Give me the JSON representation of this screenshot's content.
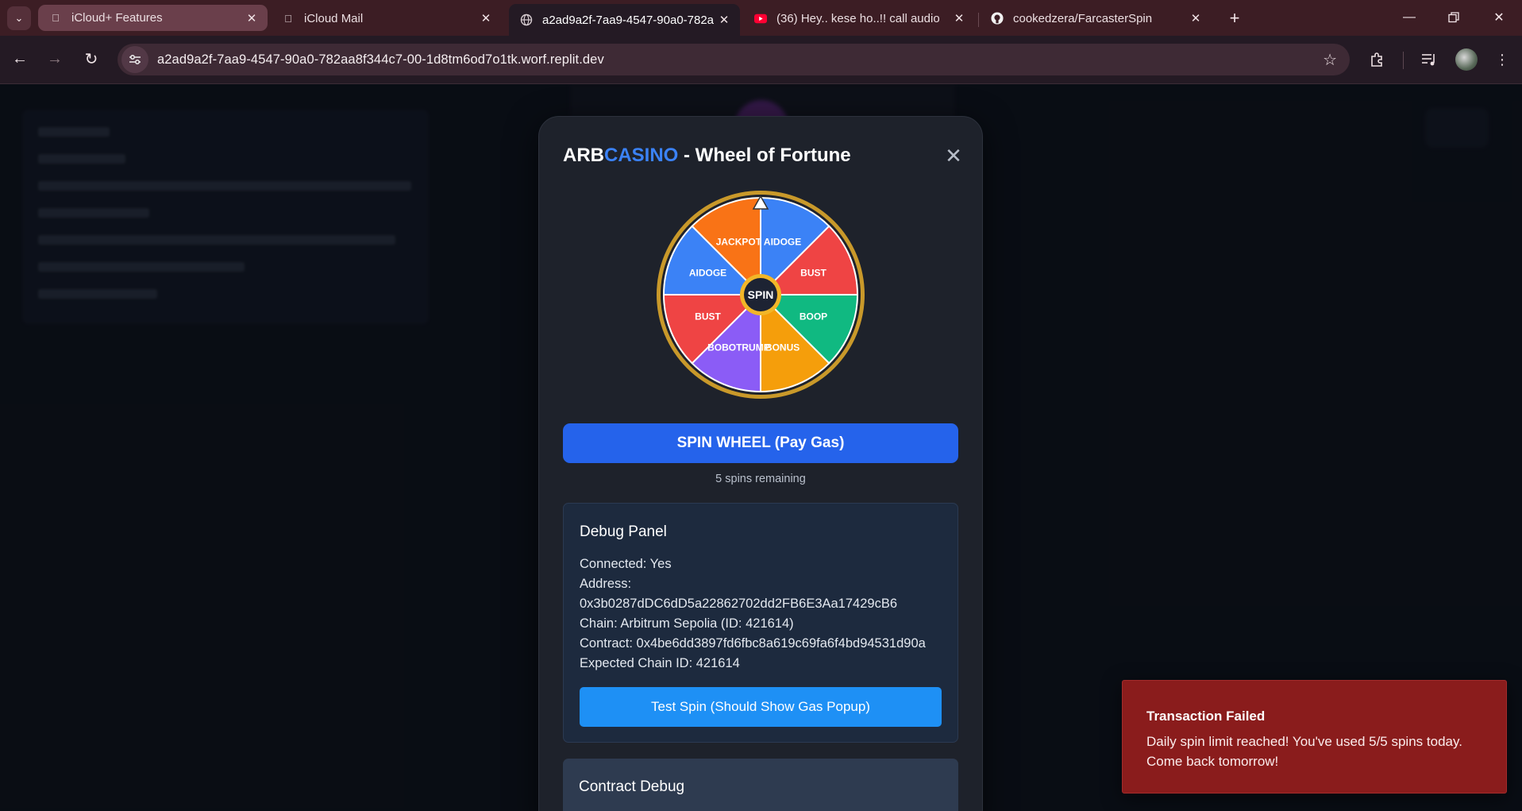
{
  "browser": {
    "tabs": [
      {
        "title": "iCloud+ Features",
        "favicon": "apple-icon",
        "state": "first"
      },
      {
        "title": "iCloud Mail",
        "favicon": "apple-icon",
        "state": "normal"
      },
      {
        "title": "a2ad9a2f-7aa9-4547-90a0-782a",
        "favicon": "globe-icon",
        "state": "active"
      },
      {
        "title": "(36) Hey.. kese ho..!! call audio",
        "favicon": "youtube-icon",
        "state": "normal"
      },
      {
        "title": "cookedzera/FarcasterSpin",
        "favicon": "github-icon",
        "state": "normal"
      }
    ],
    "url": "a2ad9a2f-7aa9-4547-90a0-782aa8f344c7-00-1d8tm6od7o1tk.worf.replit.dev"
  },
  "modal": {
    "title_prefix": "ARB",
    "title_accent": "CASINO",
    "title_suffix": " - Wheel of Fortune",
    "accent_color": "#3b82f6",
    "close_icon": "close-icon",
    "wheel": {
      "center_label": "SPIN",
      "segments": [
        {
          "label": "AIDOGE",
          "color": "#3b82f6"
        },
        {
          "label": "BUST",
          "color": "#ef4444"
        },
        {
          "label": "BOOP",
          "color": "#10b981"
        },
        {
          "label": "BONUS",
          "color": "#f59e0b"
        },
        {
          "label": "BOBOTRUMP",
          "color": "#8b5cf6"
        },
        {
          "label": "BUST",
          "color": "#ef4444"
        },
        {
          "label": "AIDOGE",
          "color": "#3b82f6"
        },
        {
          "label": "JACKPOT",
          "color": "#f97316"
        }
      ]
    },
    "spin_button": "SPIN WHEEL (Pay Gas)",
    "spins_remaining": "5 spins remaining",
    "debug_panel": {
      "title": "Debug Panel",
      "lines": [
        "Connected: Yes",
        "Address:",
        "0x3b0287dDC6dD5a22862702dd2FB6E3Aa17429cB6",
        "Chain: Arbitrum Sepolia (ID: 421614)",
        "Contract: 0x4be6dd3897fd6fbc8a619c69fa6f4bd94531d90a",
        "Expected Chain ID: 421614"
      ],
      "test_button": "Test Spin (Should Show Gas Popup)"
    },
    "contract_debug": {
      "title": "Contract Debug"
    }
  },
  "toast": {
    "title": "Transaction Failed",
    "message": "Daily spin limit reached! You've used 5/5 spins today. Come back tomorrow!",
    "color": "#8a1c1c"
  }
}
